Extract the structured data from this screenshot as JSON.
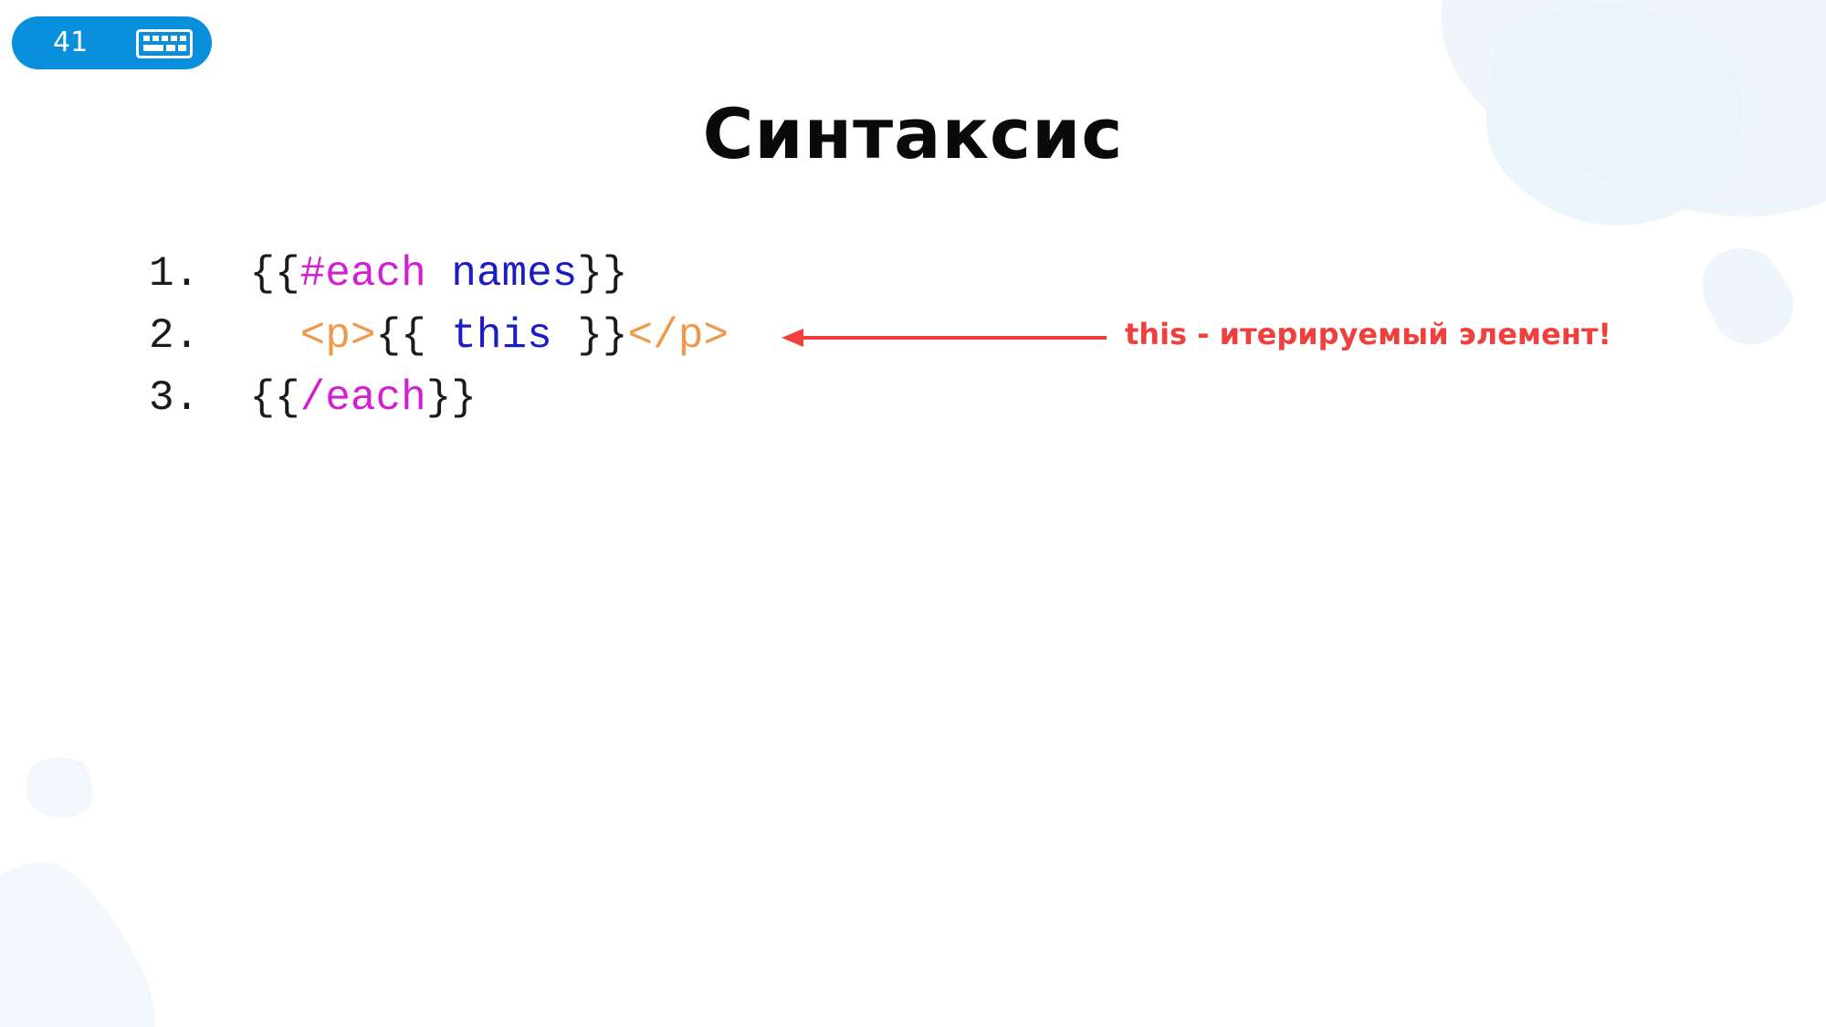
{
  "slide": {
    "number": "41",
    "title": "Синтаксис"
  },
  "code": {
    "lines": [
      {
        "num": "1.",
        "indent": "  ",
        "open": "{{",
        "keyword": "#each",
        "space": " ",
        "ident": "names",
        "close": "}}"
      },
      {
        "num": "2.",
        "indent": "    ",
        "tag_open": "<p>",
        "open": "{{ ",
        "ident": "this",
        "close": " }}",
        "tag_close": "</p>"
      },
      {
        "num": "3.",
        "indent": "  ",
        "open": "{{",
        "keyword": "/each",
        "close": "}}"
      }
    ]
  },
  "annotation": {
    "text": "this - итерируемый элемент!",
    "color": "#f0403e"
  },
  "colors": {
    "pill": "#0a8fdc",
    "keyword": "#d21fd2",
    "identifier": "#1c1cc7",
    "tag": "#ef9a4b"
  },
  "icons": {
    "pill_icon": "keyboard-icon"
  }
}
